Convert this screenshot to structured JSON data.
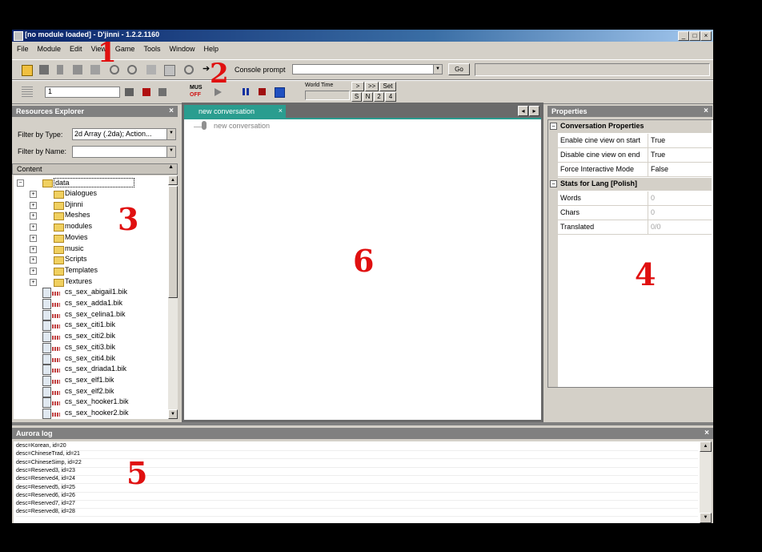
{
  "window": {
    "title": "[no module loaded] - D'jinni - 1.2.2.1160",
    "controls": [
      "_",
      "□",
      "×"
    ]
  },
  "menu": [
    "File",
    "Module",
    "Edit",
    "View",
    "Game",
    "Tools",
    "Window",
    "Help"
  ],
  "toolbar1": {
    "console_label": "Console prompt",
    "console_value": "",
    "go_label": "Go"
  },
  "toolbar2": {
    "number_value": "1",
    "mus_label": "MUS",
    "off_label": "OFF",
    "world_time_label": "World Time",
    "btn_next": ">",
    "btn_fast": ">>",
    "btn_set": "Set",
    "btn_s": "S",
    "btn_n": "N",
    "btn_2": "2",
    "btn_4": "4"
  },
  "resources": {
    "title": "Resources Explorer",
    "close": "×",
    "filter_type_label": "Filter by Type:",
    "filter_type_value": "2d Array (.2da); Action...",
    "filter_name_label": "Filter by Name:",
    "filter_name_value": "",
    "content_label": "Content",
    "root": "data",
    "folders": [
      "Dialogues",
      "Djinni",
      "Meshes",
      "modules",
      "Movies",
      "music",
      "Scripts",
      "Templates",
      "Textures"
    ],
    "files": [
      "cs_sex_abigail1.bik",
      "cs_sex_adda1.bik",
      "cs_sex_celina1.bik",
      "cs_sex_citi1.bik",
      "cs_sex_citi2.bik",
      "cs_sex_citi3.bik",
      "cs_sex_citi4.bik",
      "cs_sex_driada1.bik",
      "cs_sex_elf1.bik",
      "cs_sex_elf2.bik",
      "cs_sex_hooker1.bik",
      "cs_sex_hooker2.bik"
    ]
  },
  "editor": {
    "tab_label": "new conversation",
    "tab_close": "×",
    "node_label": "new conversation",
    "nav_left": "◂",
    "nav_right": "▸"
  },
  "properties": {
    "title": "Properties",
    "close": "×",
    "cat1": "Conversation Properties",
    "rows1": [
      {
        "k": "Enable cine view on start",
        "v": "True"
      },
      {
        "k": "Disable cine view on end",
        "v": "True"
      },
      {
        "k": "Force Interactive Mode",
        "v": "False"
      }
    ],
    "cat2": "Stats for Lang [Polish]",
    "rows2": [
      {
        "k": "Words",
        "v": "0"
      },
      {
        "k": "Chars",
        "v": "0"
      },
      {
        "k": "Translated",
        "v": "0/0"
      }
    ]
  },
  "log": {
    "title": "Aurora log",
    "close": "×",
    "lines": [
      "desc=Korean, id=20",
      "desc=ChineseTrad, id=21",
      "desc=ChineseSimp, id=22",
      "desc=Reserved3, id=23",
      "desc=Reserved4, id=24",
      "desc=Reserved5, id=25",
      "desc=Reserved6, id=26",
      "desc=Reserved7, id=27",
      "desc=Reserved8, id=28"
    ]
  },
  "annotations": {
    "n1": "1",
    "n2": "2",
    "n3": "3",
    "n4": "4",
    "n5": "5",
    "n6": "6"
  },
  "colors": {
    "accent_tab": "#2a9d8f",
    "title_blue": "#0a246a",
    "annotation_red": "#e01010"
  }
}
